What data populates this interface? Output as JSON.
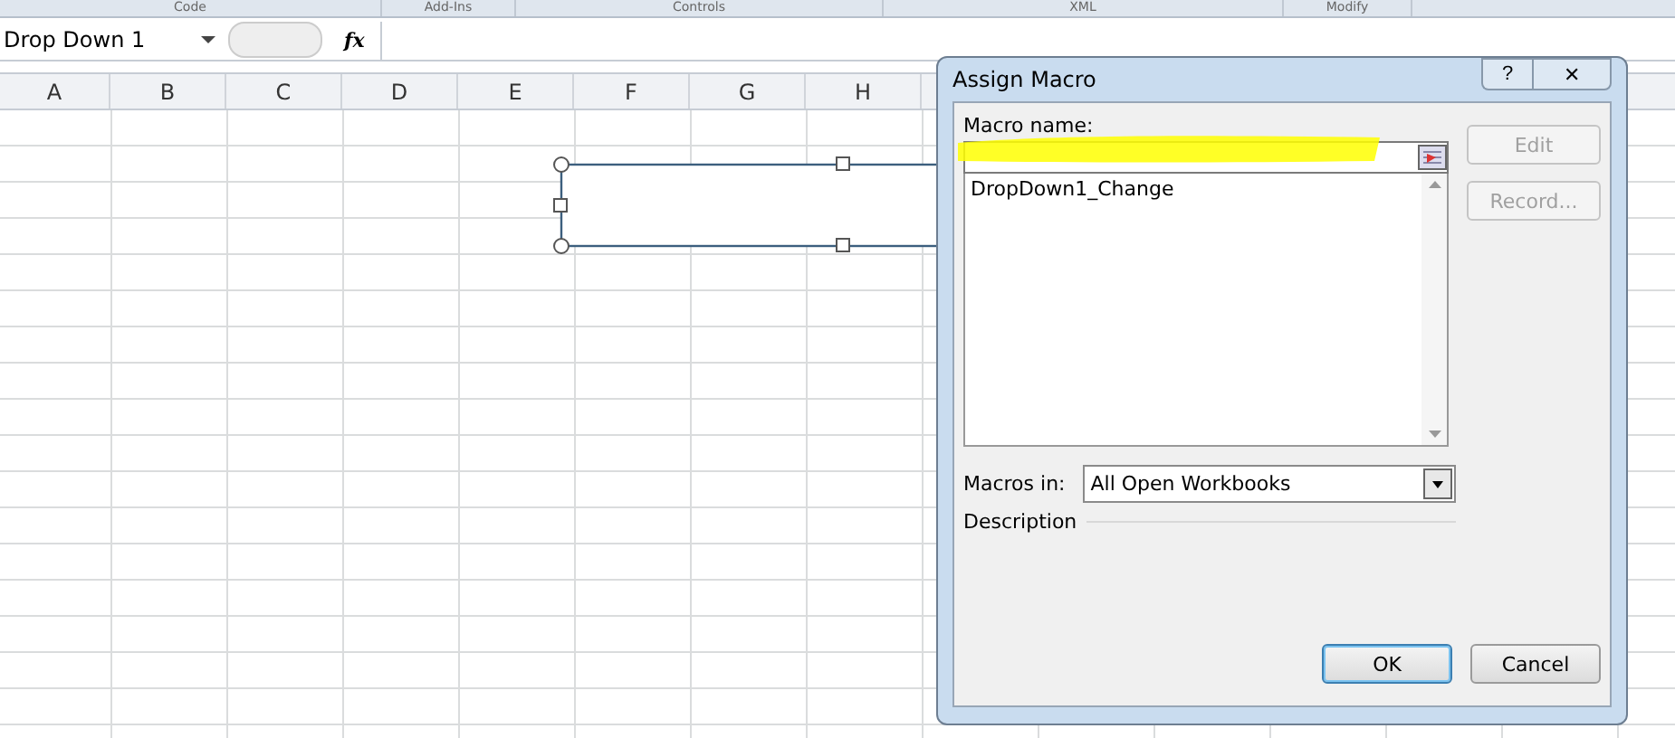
{
  "ribbon_groups": [
    "Code",
    "Add-Ins",
    "Controls",
    "XML",
    "Modify"
  ],
  "formula_bar": {
    "name_box": "Drop Down 1",
    "fx": "fx"
  },
  "columns": [
    "A",
    "B",
    "C",
    "D",
    "E",
    "F",
    "G",
    "H"
  ],
  "dialog": {
    "title": "Assign Macro",
    "help": "?",
    "close": "✕",
    "macro_name_label": "Macro name:",
    "macros": [
      {
        "name": "DropDown1_Change",
        "selected": false
      }
    ],
    "side_buttons": [
      {
        "label": "Edit",
        "disabled": true
      },
      {
        "label": "Record...",
        "disabled": true
      }
    ],
    "macros_in_label": "Macros in:",
    "macros_in": "All Open Workbooks",
    "description_label": "Description",
    "buttons": [
      {
        "label": "OK",
        "default": true
      },
      {
        "label": "Cancel",
        "default": false
      }
    ]
  }
}
